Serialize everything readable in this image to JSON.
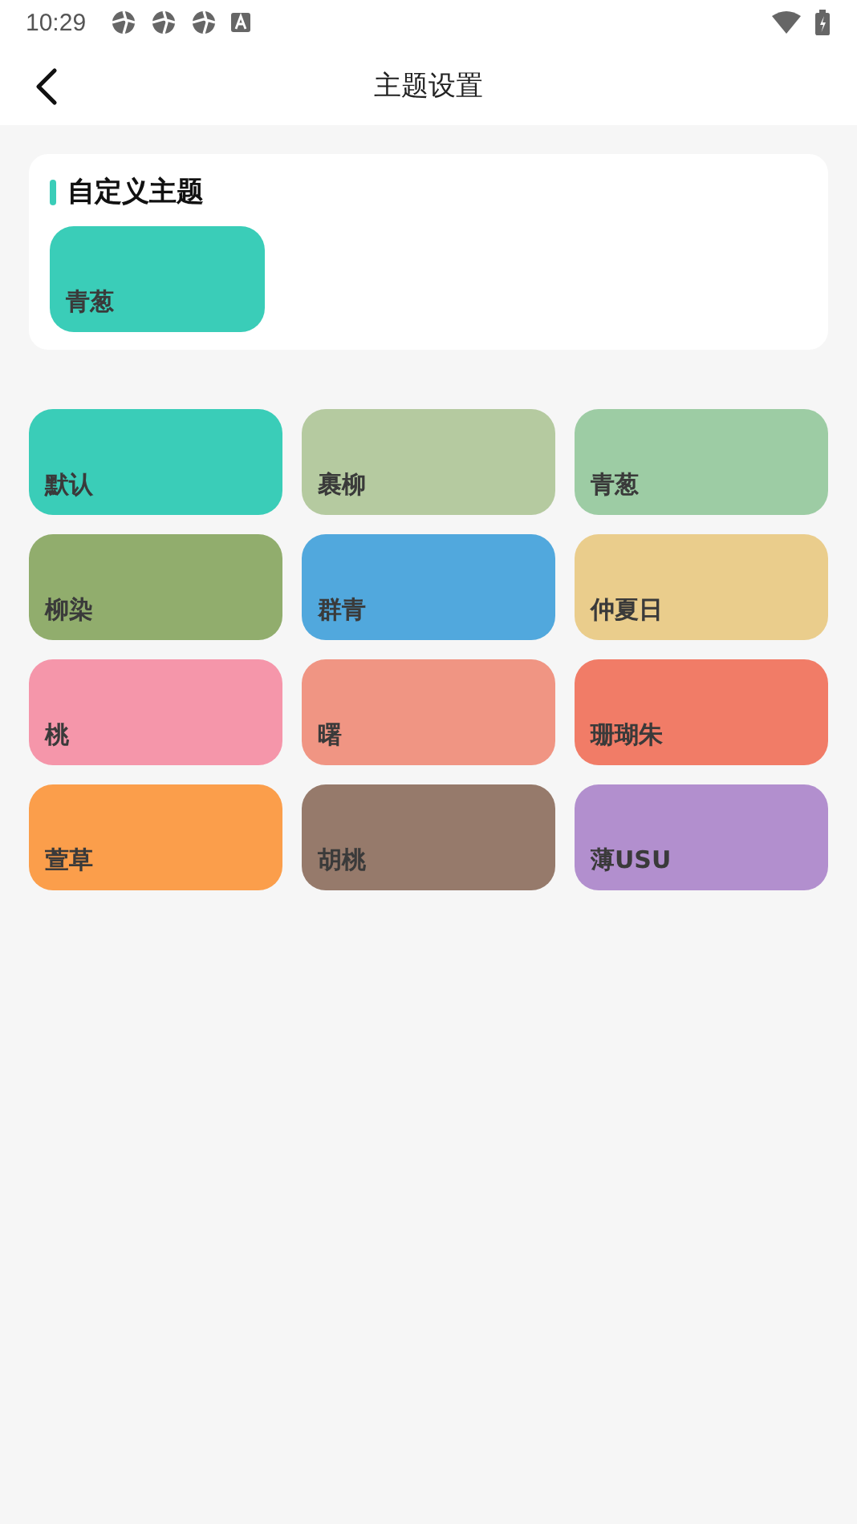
{
  "status_bar": {
    "time": "10:29"
  },
  "header": {
    "title": "主题设置"
  },
  "custom_section": {
    "title": "自定义主题",
    "themes": [
      {
        "label": "青葱",
        "color": "#3acdb8"
      }
    ]
  },
  "themes": [
    {
      "label": "默认",
      "color": "#3acdb8"
    },
    {
      "label": "裹柳",
      "color": "#b5caa0"
    },
    {
      "label": "青葱",
      "color": "#9dcca4"
    },
    {
      "label": "柳染",
      "color": "#91ad6d"
    },
    {
      "label": "群青",
      "color": "#51a8dd"
    },
    {
      "label": "仲夏日",
      "color": "#eacd8c"
    },
    {
      "label": "桃",
      "color": "#f596aa"
    },
    {
      "label": "曙",
      "color": "#f09583"
    },
    {
      "label": "珊瑚朱",
      "color": "#f17c67"
    },
    {
      "label": "萱草",
      "color": "#fb9e4b"
    },
    {
      "label": "胡桃",
      "color": "#967a6b"
    },
    {
      "label": "薄USU",
      "color": "#b28fce"
    }
  ]
}
